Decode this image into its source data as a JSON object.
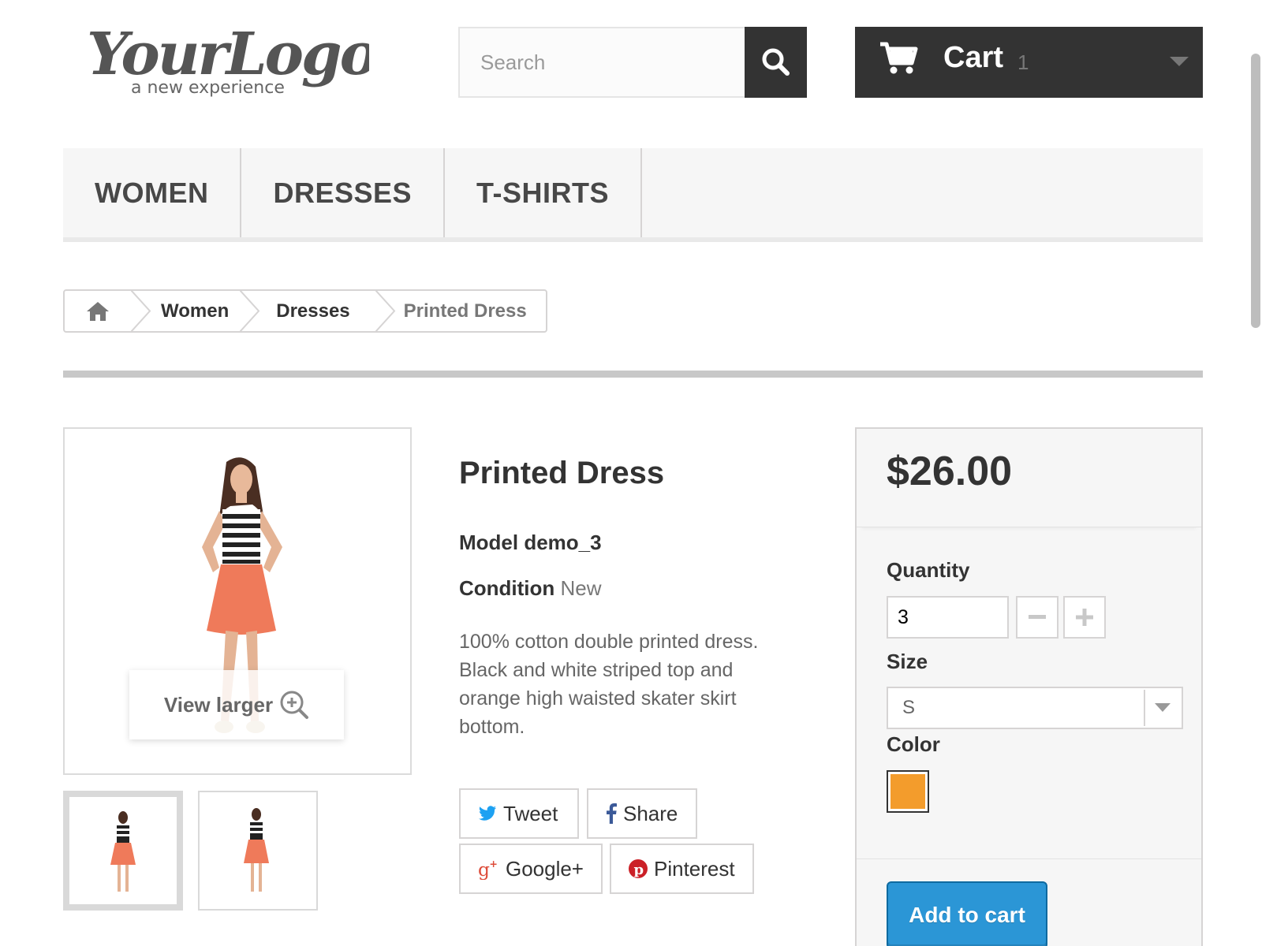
{
  "header": {
    "logo": {
      "script": "YourLogo",
      "tagline": "a new experience"
    },
    "search": {
      "placeholder": "Search",
      "value": ""
    },
    "cart": {
      "label": "Cart",
      "count": "1"
    }
  },
  "menu": {
    "items": [
      {
        "label": "WOMEN"
      },
      {
        "label": "DRESSES"
      },
      {
        "label": "T-SHIRTS"
      }
    ]
  },
  "breadcrumb": {
    "items": [
      {
        "label": "Women"
      },
      {
        "label": "Dresses"
      },
      {
        "label": "Printed Dress"
      }
    ]
  },
  "gallery": {
    "view_larger": "View larger"
  },
  "product": {
    "title": "Printed Dress",
    "model": "Model demo_3",
    "condition_label": "Condition",
    "condition_value": "New",
    "description": "100% cotton double printed dress. Black and white striped top and orange high waisted skater skirt bottom."
  },
  "social": {
    "tweet": "Tweet",
    "share": "Share",
    "google": "Google+",
    "pinterest": "Pinterest"
  },
  "buybox": {
    "price": "$26.00",
    "quantity_label": "Quantity",
    "quantity_value": "3",
    "size_label": "Size",
    "size_value": "S",
    "color_label": "Color",
    "add_to_cart": "Add to cart"
  },
  "colors": {
    "dark": "#333333",
    "accent_blue": "#2b96d6",
    "swatch_orange": "#f39c2c",
    "skirt_coral": "#ef7a5a",
    "twitter": "#1da1f2",
    "facebook": "#3b5998",
    "google": "#dd4b39",
    "pinterest": "#cb2027"
  }
}
